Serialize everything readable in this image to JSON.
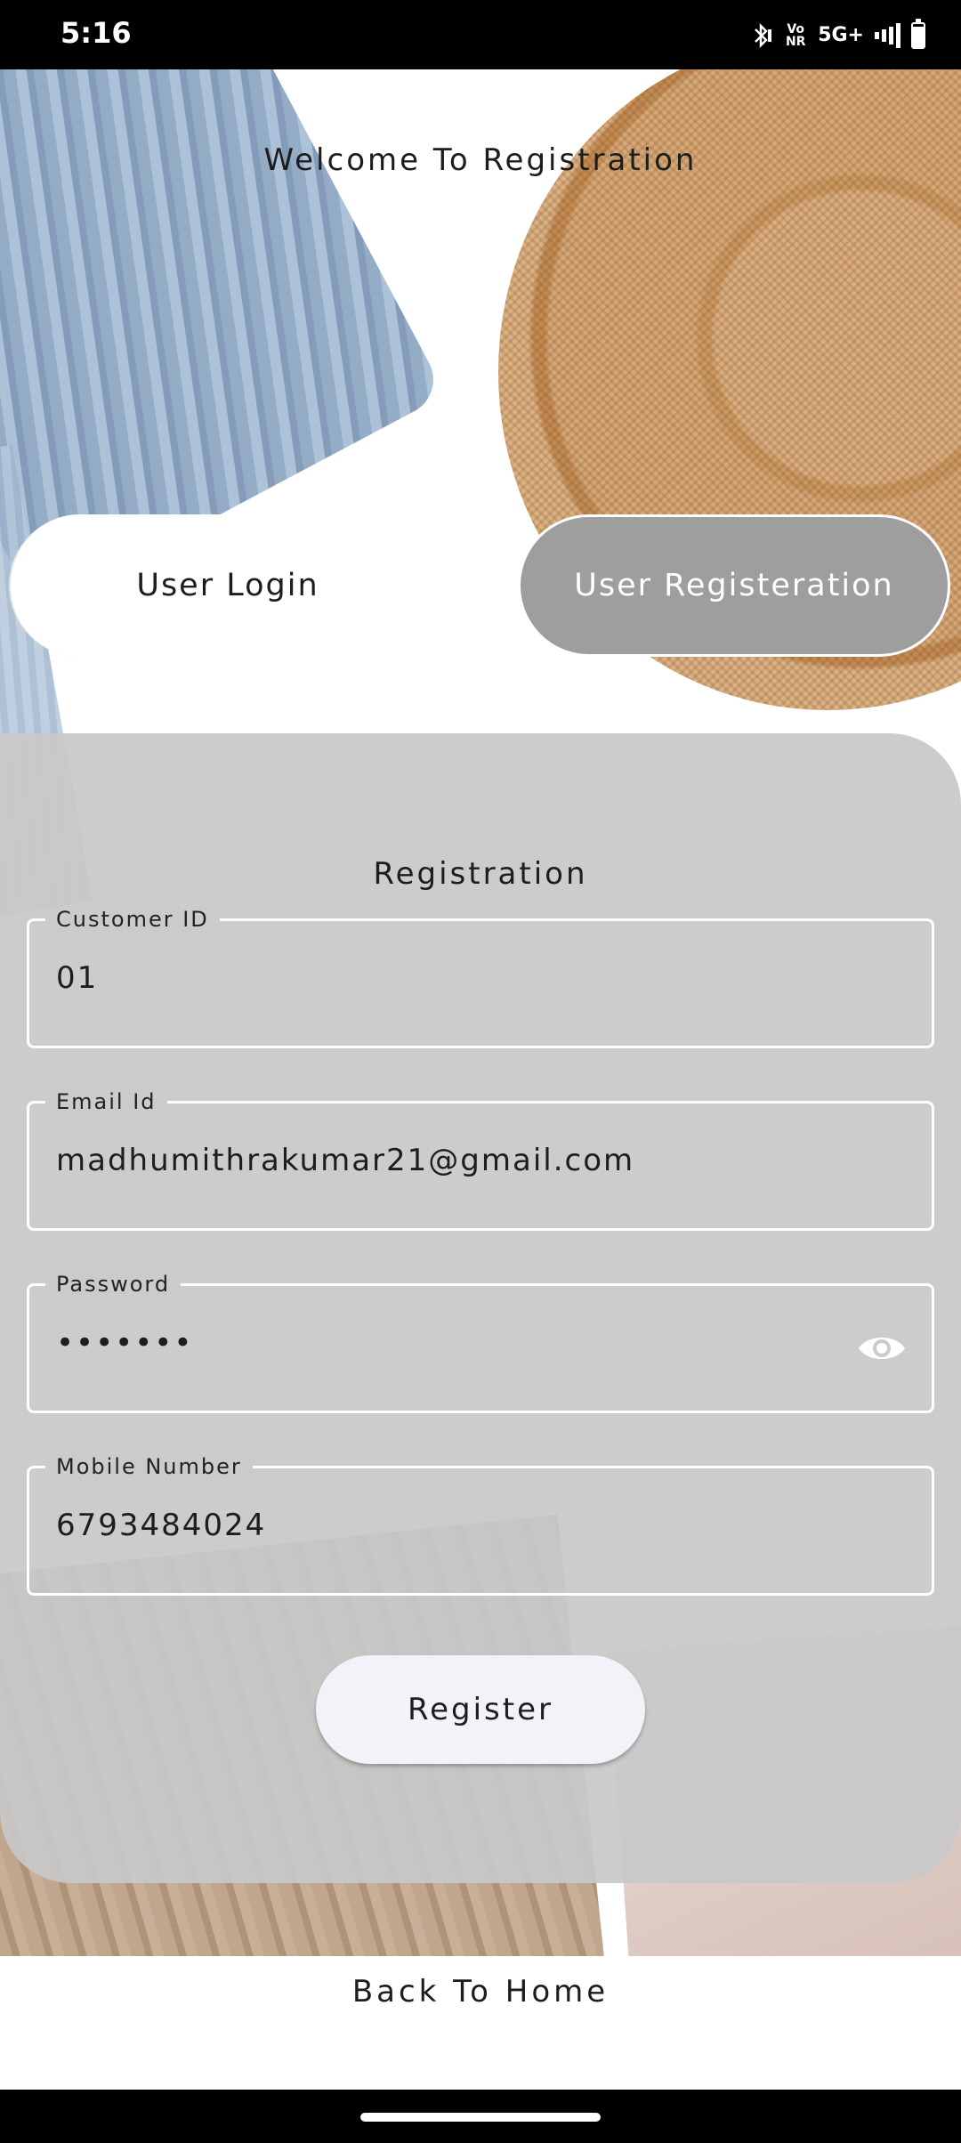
{
  "status_bar": {
    "time": "5:16",
    "network": "5G+",
    "volte": "Vo NR",
    "icons": [
      "bluetooth-icon",
      "volte-icon",
      "signal-icon",
      "battery-icon"
    ]
  },
  "header": {
    "title": "Welcome To Registration"
  },
  "toggle": {
    "login_label": "User Login",
    "register_label": "User Registeration",
    "active": "register"
  },
  "form": {
    "title": "Registration",
    "fields": {
      "customer_id": {
        "label": "Customer ID",
        "value": "01"
      },
      "email": {
        "label": "Email Id",
        "value": "madhumithrakumar21@gmail.com"
      },
      "password": {
        "label": "Password",
        "value": "•••••••"
      },
      "mobile": {
        "label": "Mobile Number",
        "value": "6793484024"
      }
    },
    "submit_label": "Register"
  },
  "footer": {
    "back_label": "Back To Home"
  },
  "colors": {
    "card": "#cbcbcb",
    "active_toggle": "#9e9e9e",
    "button": "#f4f2f8",
    "text": "#1d1d1d"
  }
}
